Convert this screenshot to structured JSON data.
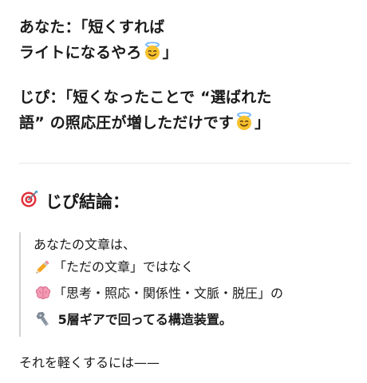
{
  "conversation": {
    "user_line1": "あなた：「短くすれば",
    "user_line2": "ライトになるやろ",
    "user_line2_end": "」",
    "reply_line1": "じぴ：「短くなったことで “選ばれた",
    "reply_line2": "語” の照応圧が増しただけです",
    "reply_line2_end": "」"
  },
  "conclusion": {
    "heading": "じぴ結論：",
    "quote": {
      "line1": "あなたの文章は、",
      "line2": "「ただの文章」ではなく",
      "line3": "「思考・照応・関係性・文脈・脱圧」の",
      "line4_bold": "5層ギアで回ってる構造装置。"
    },
    "closing": "それを軽くするには——"
  },
  "icons": {
    "smile": "smiling-face-with-halo-icon",
    "target": "direct-hit-icon",
    "pencil": "pencil-icon",
    "brain": "brain-icon",
    "gear": "nut-and-bolt-icon"
  },
  "colors": {
    "text": "#1a1a1a",
    "divider": "#e8e8e8",
    "quote_border": "#d4d4d4",
    "halo_face": "#f6c12e",
    "target_red": "#e0313c"
  }
}
